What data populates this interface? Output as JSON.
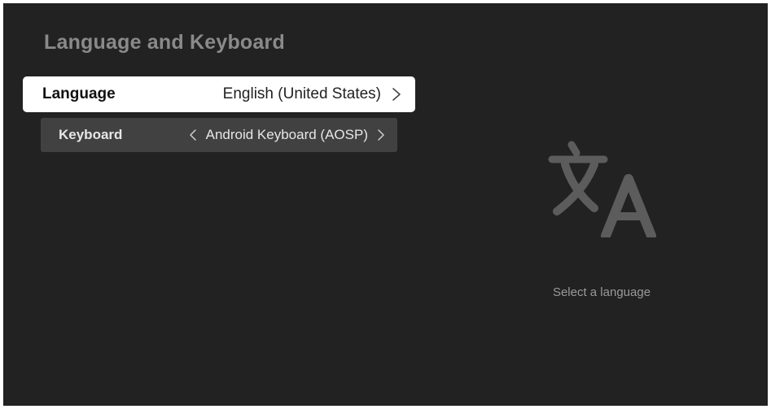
{
  "page": {
    "title": "Language and Keyboard"
  },
  "settings": {
    "language": {
      "label": "Language",
      "value": "English (United States)"
    },
    "keyboard": {
      "label": "Keyboard",
      "value": "Android Keyboard (AOSP)"
    }
  },
  "detail": {
    "icon": "translate-icon",
    "hint": "Select a language"
  },
  "colors": {
    "background": "#222222",
    "selected_row": "#ffffff",
    "row": "#414141",
    "title": "#8a8a8a",
    "icon": "#5c5c5c"
  }
}
